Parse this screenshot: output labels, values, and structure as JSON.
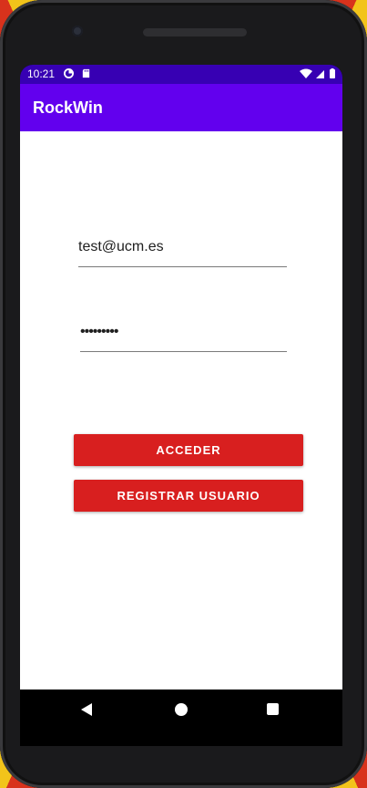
{
  "status_bar": {
    "time": "10:21"
  },
  "app_bar": {
    "title": "RockWin"
  },
  "login_form": {
    "email_value": "test@ucm.es",
    "password_value": "•••••••••"
  },
  "buttons": {
    "login_label": "ACCEDER",
    "register_label": "REGISTRAR USUARIO"
  },
  "colors": {
    "status_bar": "#3700b3",
    "app_bar": "#6200ee",
    "button": "#d81f1f"
  },
  "icons": {
    "status_left": [
      "data-saver-icon",
      "sd-card-icon"
    ],
    "status_right": [
      "wifi-icon",
      "cell-signal-icon",
      "battery-icon"
    ],
    "nav": [
      "back-icon",
      "home-icon",
      "recents-icon"
    ]
  }
}
